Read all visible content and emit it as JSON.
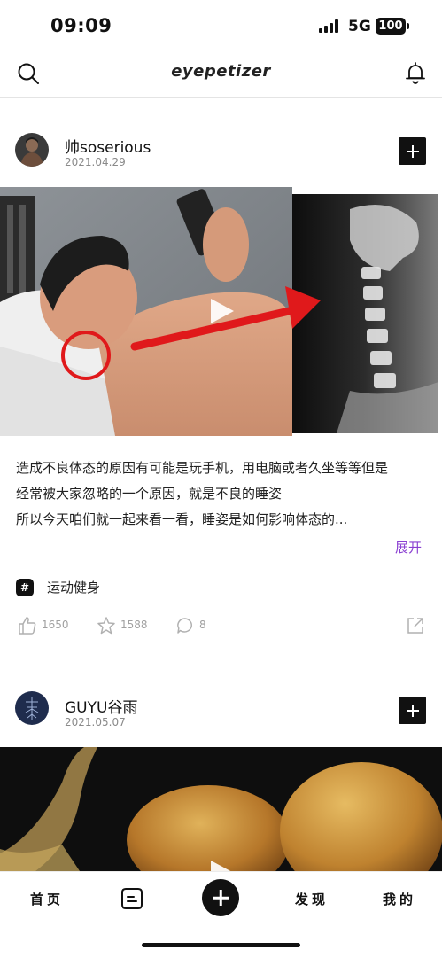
{
  "status_bar": {
    "time": "09:09",
    "network": "5G",
    "battery": "100"
  },
  "header": {
    "logo": "eyepetizer"
  },
  "feed": [
    {
      "author": "帅soserious",
      "date": "2021.04.29",
      "description_lines": [
        "造成不良体态的原因有可能是玩手机，用电脑或者久坐等等但是",
        "经常被大家忽略的一个原因，就是不良的睡姿",
        "所以今天咱们就一起来看一看，睡姿是如何影响体态的..."
      ],
      "expand_label": "展开",
      "tag": {
        "symbol": "#",
        "label": "运动健身"
      },
      "likes": "1650",
      "favorites": "1588",
      "comments": "8"
    },
    {
      "author": "GUYU谷雨",
      "date": "2021.05.07"
    }
  ],
  "bottom_nav": {
    "home": "首页",
    "discover": "发现",
    "mine": "我的"
  },
  "colors": {
    "accent_link": "#8a3fd1",
    "annotation_red": "#e0191b"
  }
}
